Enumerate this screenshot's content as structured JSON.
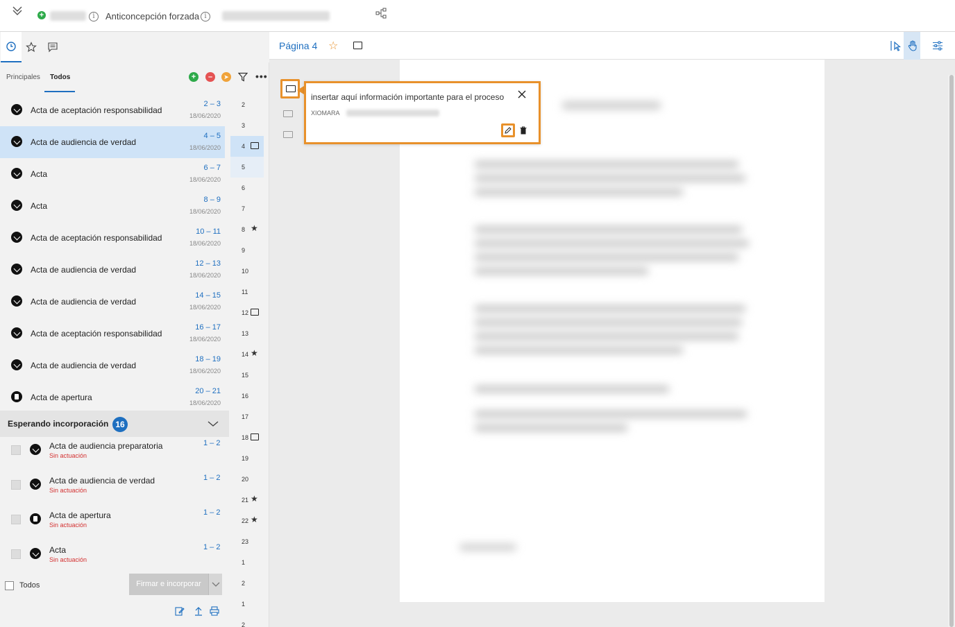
{
  "header": {
    "case_title": "Anticoncepción forzada",
    "info_glyph": "i"
  },
  "left_panel": {
    "subtabs": [
      "Principales",
      "Todos"
    ],
    "active_subtab": "Todos",
    "documents": [
      {
        "name": "Acta de aceptación responsabilidad",
        "pages": "2 – 3",
        "date": "18/06/2020",
        "icon": "signature-icon",
        "selected": false
      },
      {
        "name": "Acta de audiencia de verdad",
        "pages": "4 – 5",
        "date": "18/06/2020",
        "icon": "signature-icon",
        "selected": true
      },
      {
        "name": "Acta",
        "pages": "6 – 7",
        "date": "18/06/2020",
        "icon": "signature-icon",
        "selected": false
      },
      {
        "name": "Acta",
        "pages": "8 – 9",
        "date": "18/06/2020",
        "icon": "signature-icon",
        "selected": false
      },
      {
        "name": "Acta de aceptación responsabilidad",
        "pages": "10 – 11",
        "date": "18/06/2020",
        "icon": "signature-icon",
        "selected": false
      },
      {
        "name": "Acta de audiencia de verdad",
        "pages": "12 – 13",
        "date": "18/06/2020",
        "icon": "signature-icon",
        "selected": false
      },
      {
        "name": "Acta de audiencia de verdad",
        "pages": "14 – 15",
        "date": "18/06/2020",
        "icon": "signature-icon",
        "selected": false
      },
      {
        "name": "Acta de aceptación responsabilidad",
        "pages": "16 – 17",
        "date": "18/06/2020",
        "icon": "signature-icon",
        "selected": false
      },
      {
        "name": "Acta de audiencia de verdad",
        "pages": "18 – 19",
        "date": "18/06/2020",
        "icon": "signature-icon",
        "selected": false
      },
      {
        "name": "Acta de apertura",
        "pages": "20 – 21",
        "date": "18/06/2020",
        "icon": "file-icon",
        "selected": false
      }
    ],
    "page_numbers": [
      {
        "n": "2",
        "mark": ""
      },
      {
        "n": "3",
        "mark": ""
      },
      {
        "n": "4",
        "mark": "comment"
      },
      {
        "n": "5",
        "mark": ""
      },
      {
        "n": "6",
        "mark": ""
      },
      {
        "n": "7",
        "mark": ""
      },
      {
        "n": "8",
        "mark": "star"
      },
      {
        "n": "9",
        "mark": ""
      },
      {
        "n": "10",
        "mark": ""
      },
      {
        "n": "11",
        "mark": ""
      },
      {
        "n": "12",
        "mark": "comment"
      },
      {
        "n": "13",
        "mark": ""
      },
      {
        "n": "14",
        "mark": "star"
      },
      {
        "n": "15",
        "mark": ""
      },
      {
        "n": "16",
        "mark": ""
      },
      {
        "n": "17",
        "mark": ""
      },
      {
        "n": "18",
        "mark": "comment"
      },
      {
        "n": "19",
        "mark": ""
      },
      {
        "n": "20",
        "mark": ""
      },
      {
        "n": "21",
        "mark": "star"
      },
      {
        "n": "22",
        "mark": "star"
      },
      {
        "n": "23",
        "mark": ""
      },
      {
        "n": "1",
        "mark": ""
      },
      {
        "n": "2",
        "mark": ""
      },
      {
        "n": "1",
        "mark": ""
      },
      {
        "n": "2",
        "mark": ""
      }
    ],
    "pending": {
      "title": "Esperando incorporación",
      "count": "16",
      "items": [
        {
          "name": "Acta de audiencia preparatoria",
          "status": "Sin actuación",
          "pages": "1 – 2",
          "icon": "signature-icon"
        },
        {
          "name": "Acta de audiencia de verdad",
          "status": "Sin actuación",
          "pages": "1 – 2",
          "icon": "signature-icon"
        },
        {
          "name": "Acta de apertura",
          "status": "Sin actuación",
          "pages": "1 – 2",
          "icon": "file-icon"
        },
        {
          "name": "Acta",
          "status": "Sin actuación",
          "pages": "1 – 2",
          "icon": "signature-icon"
        }
      ]
    },
    "select_all_label": "Todos",
    "sign_button_label": "Firmar e incorporar"
  },
  "viewer": {
    "page_label": "Página 4",
    "star_glyph": "☆",
    "comment": {
      "text": "insertar aquí información importante para el proceso",
      "author": "XIOMARA"
    }
  },
  "colors": {
    "accent": "#1e6fc0",
    "highlight": "#e8912b",
    "selected_row": "#cfe3f7",
    "status_red": "#d32f2f"
  }
}
